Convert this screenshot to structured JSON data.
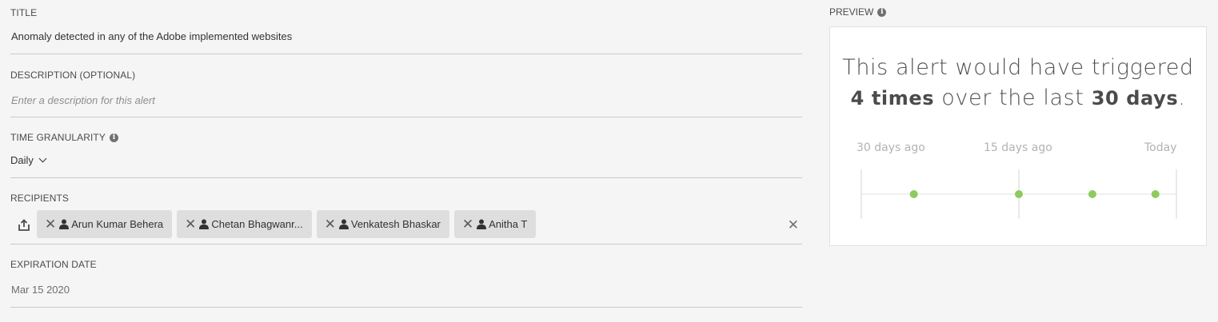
{
  "form": {
    "title": {
      "label": "TITLE",
      "value": "Anomaly detected in any of the Adobe implemented websites"
    },
    "description": {
      "label": "DESCRIPTION (OPTIONAL)",
      "placeholder": "Enter a description for this alert",
      "value": ""
    },
    "time_granularity": {
      "label": "TIME GRANULARITY",
      "selected": "Daily",
      "icon": "info-icon"
    },
    "recipients": {
      "label": "RECIPIENTS",
      "items": [
        {
          "name": "Arun Kumar Behera"
        },
        {
          "name": "Chetan Bhagwanr..."
        },
        {
          "name": "Venkatesh Bhaskar"
        },
        {
          "name": "Anitha T"
        }
      ]
    },
    "expiration_date": {
      "label": "EXPIRATION DATE",
      "value": "Mar 15 2020"
    }
  },
  "preview": {
    "label": "PREVIEW",
    "text_before": "This alert would have triggered",
    "count": "4 times",
    "text_middle": " over the last ",
    "period": "30 days",
    "text_end": ".",
    "timeline": {
      "labels": [
        "30 days ago",
        "15 days ago",
        "Today"
      ],
      "days_ago_range": [
        30,
        0
      ],
      "trigger_days_ago": [
        25,
        15,
        8,
        2
      ],
      "dot_color": "#8dcb5f"
    }
  }
}
